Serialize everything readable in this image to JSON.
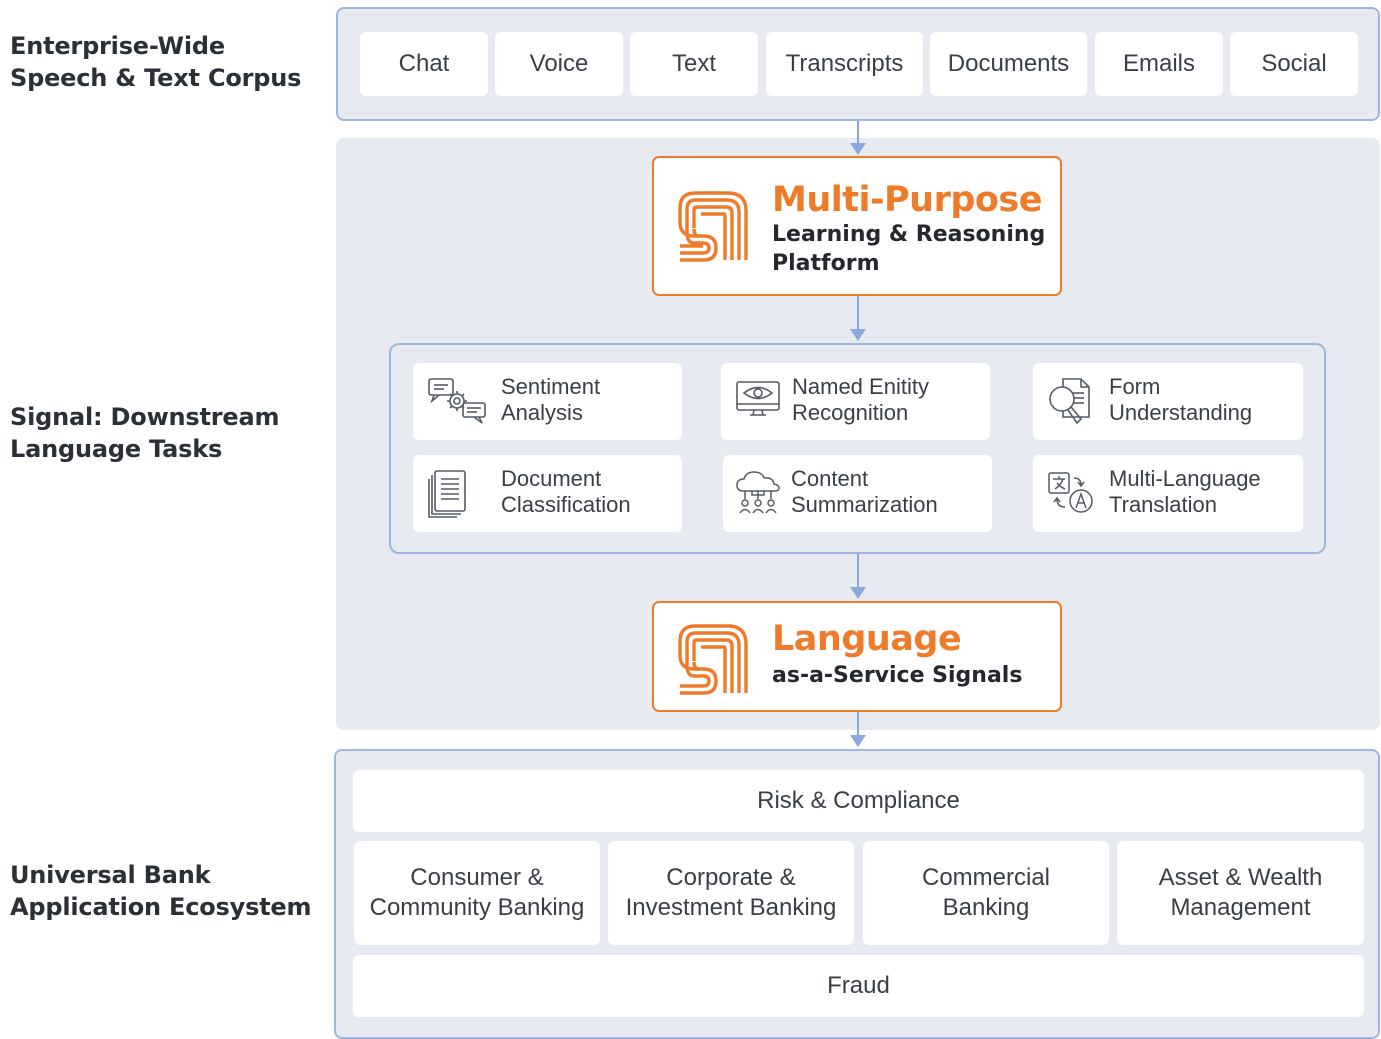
{
  "labels": {
    "corpus": "Enterprise-Wide\nSpeech & Text Corpus",
    "signal": "Signal: Downstream\nLanguage Tasks",
    "ecosystem": "Universal Bank\nApplication Ecosystem"
  },
  "sources": [
    "Chat",
    "Voice",
    "Text",
    "Transcripts",
    "Documents",
    "Emails",
    "Social"
  ],
  "platform": {
    "title": "Multi-Purpose",
    "subtitle": "Learning & Reasoning\nPlatform",
    "logo_icon": "s1-logo-icon"
  },
  "tasks": [
    {
      "label": "Sentiment\nAnalysis",
      "icon": "chat-gear-icon"
    },
    {
      "label": "Named Enitity\nRecognition",
      "icon": "monitor-eye-icon"
    },
    {
      "label": "Form\nUnderstanding",
      "icon": "document-magnifier-icon"
    },
    {
      "label": "Document\nClassification",
      "icon": "stacked-documents-icon"
    },
    {
      "label": "Content\nSummarization",
      "icon": "cloud-network-icon"
    },
    {
      "label": "Multi-Language\nTranslation",
      "icon": "translate-icon"
    }
  ],
  "service": {
    "title": "Language",
    "subtitle": "as-a-Service Signals",
    "logo_icon": "s1-logo-icon"
  },
  "ecosystem": {
    "top": "Risk & Compliance",
    "lines": [
      "Consumer &\nCommunity Banking",
      "Corporate &\nInvestment Banking",
      "Commercial\nBanking",
      "Asset & Wealth\nManagement"
    ],
    "bottom": "Fraud"
  },
  "colors": {
    "accent": "#ee7b2a",
    "connector": "#8aa8e0",
    "panel": "#e8eaf1",
    "panel_border": "#9fb6e2"
  }
}
